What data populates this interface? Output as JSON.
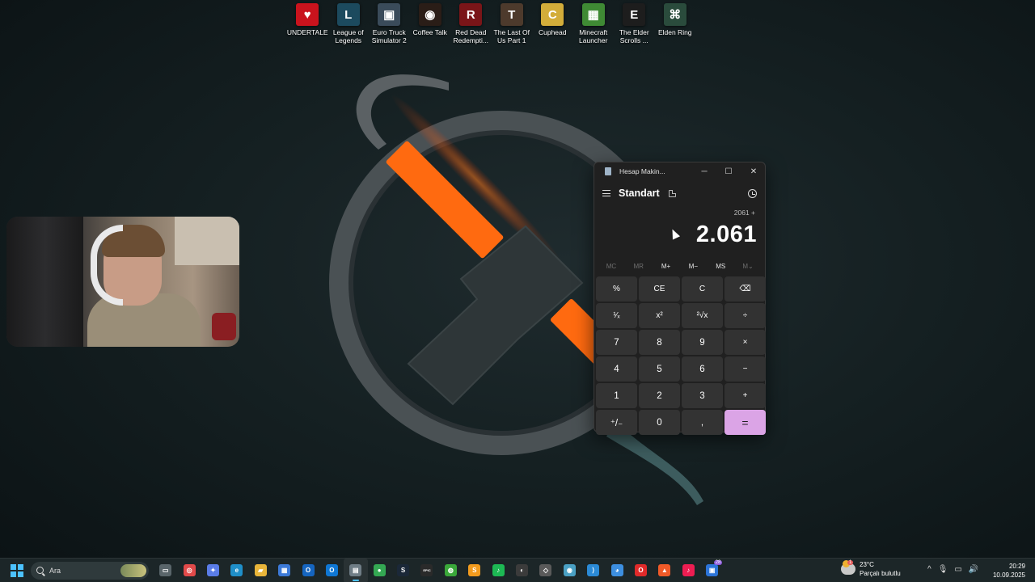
{
  "desktop_icons": [
    {
      "label": "UNDERTALE",
      "color": "#c9131d",
      "glyph": "♥"
    },
    {
      "label": "League of Legends",
      "color": "#1c4a5e",
      "glyph": "L"
    },
    {
      "label": "Euro Truck Simulator 2",
      "color": "#3a4b5a",
      "glyph": "▣"
    },
    {
      "label": "Coffee Talk",
      "color": "#2a1d17",
      "glyph": "◉"
    },
    {
      "label": "Red Dead Redempti...",
      "color": "#7a1518",
      "glyph": "R"
    },
    {
      "label": "The Last Of Us Part 1",
      "color": "#4d3a2c",
      "glyph": "T"
    },
    {
      "label": "Cuphead",
      "color": "#d3ad3a",
      "glyph": "C"
    },
    {
      "label": "Minecraft Launcher",
      "color": "#3f8a34",
      "glyph": "▦"
    },
    {
      "label": "The Elder Scrolls ...",
      "color": "#1d1d1d",
      "glyph": "E"
    },
    {
      "label": "Elden Ring",
      "color": "#2a4b3c",
      "glyph": "⌘"
    }
  ],
  "calculator": {
    "window_title": "Hesap Makin...",
    "mode": "Standart",
    "expression": "2061 +",
    "display": "2.061",
    "memory": [
      {
        "label": "MC",
        "enabled": false
      },
      {
        "label": "MR",
        "enabled": false
      },
      {
        "label": "M+",
        "enabled": true
      },
      {
        "label": "M−",
        "enabled": true
      },
      {
        "label": "MS",
        "enabled": true
      },
      {
        "label": "M⌄",
        "enabled": false
      }
    ],
    "keys": [
      {
        "label": "%",
        "kind": "op",
        "name": "percent-button"
      },
      {
        "label": "CE",
        "kind": "op",
        "name": "clear-entry-button"
      },
      {
        "label": "C",
        "kind": "op",
        "name": "clear-button"
      },
      {
        "label": "⌫",
        "kind": "op",
        "name": "backspace-button"
      },
      {
        "label": "¹⁄ₓ",
        "kind": "op",
        "name": "reciprocal-button"
      },
      {
        "label": "x²",
        "kind": "op",
        "name": "square-button"
      },
      {
        "label": "²√x",
        "kind": "op",
        "name": "square-root-button"
      },
      {
        "label": "÷",
        "kind": "op",
        "name": "divide-button"
      },
      {
        "label": "7",
        "kind": "num",
        "name": "digit-7-button"
      },
      {
        "label": "8",
        "kind": "num",
        "name": "digit-8-button"
      },
      {
        "label": "9",
        "kind": "num",
        "name": "digit-9-button"
      },
      {
        "label": "×",
        "kind": "op",
        "name": "multiply-button"
      },
      {
        "label": "4",
        "kind": "num",
        "name": "digit-4-button"
      },
      {
        "label": "5",
        "kind": "num",
        "name": "digit-5-button"
      },
      {
        "label": "6",
        "kind": "num",
        "name": "digit-6-button"
      },
      {
        "label": "−",
        "kind": "op",
        "name": "subtract-button"
      },
      {
        "label": "1",
        "kind": "num",
        "name": "digit-1-button"
      },
      {
        "label": "2",
        "kind": "num",
        "name": "digit-2-button"
      },
      {
        "label": "3",
        "kind": "num",
        "name": "digit-3-button"
      },
      {
        "label": "+",
        "kind": "op",
        "name": "add-button"
      },
      {
        "label": "⁺/₋",
        "kind": "num",
        "name": "negate-button"
      },
      {
        "label": "0",
        "kind": "num",
        "name": "digit-0-button"
      },
      {
        "label": ",",
        "kind": "num",
        "name": "decimal-button"
      },
      {
        "label": "=",
        "kind": "eq",
        "name": "equals-button"
      }
    ]
  },
  "taskbar": {
    "search_placeholder": "Ara",
    "apps": [
      {
        "name": "task-view",
        "glyph": "▭",
        "color": "#59656a"
      },
      {
        "name": "chrome-game",
        "glyph": "◎",
        "color": "#e24a4a"
      },
      {
        "name": "copilot",
        "glyph": "✦",
        "color": "#5a7de8"
      },
      {
        "name": "edge",
        "glyph": "e",
        "color": "#1f8fc9"
      },
      {
        "name": "file-explorer",
        "glyph": "▰",
        "color": "#e8b53a"
      },
      {
        "name": "store",
        "glyph": "▦",
        "color": "#3c7ad8"
      },
      {
        "name": "outlook",
        "glyph": "O",
        "color": "#1565c0"
      },
      {
        "name": "outlook-new",
        "glyph": "O",
        "color": "#0f77d4"
      },
      {
        "name": "calculator",
        "glyph": "▤",
        "color": "#6f7d86"
      },
      {
        "name": "chrome",
        "glyph": "●",
        "color": "#34a853"
      },
      {
        "name": "steam",
        "glyph": "S",
        "color": "#1b2838"
      },
      {
        "name": "epic-games",
        "glyph": "EPIC",
        "color": "#2a2a2a"
      },
      {
        "name": "xbox-like",
        "glyph": "◍",
        "color": "#3aa83a"
      },
      {
        "name": "sublime",
        "glyph": "S",
        "color": "#f29b1e"
      },
      {
        "name": "spotify",
        "glyph": "♪",
        "color": "#1db954"
      },
      {
        "name": "obs",
        "glyph": "◐",
        "color": "#3b3b3b"
      },
      {
        "name": "unity-like",
        "glyph": "◇",
        "color": "#5a5a5a"
      },
      {
        "name": "globe",
        "glyph": "◉",
        "color": "#4aa0c4"
      },
      {
        "name": "vscode",
        "glyph": "⟩",
        "color": "#2b8ad6"
      },
      {
        "name": "whale-app",
        "glyph": "◕",
        "color": "#3d8fe0"
      },
      {
        "name": "opera",
        "glyph": "O",
        "color": "#e02a2a"
      },
      {
        "name": "brave",
        "glyph": "▲",
        "color": "#f05a28"
      },
      {
        "name": "tiktok",
        "glyph": "♪",
        "color": "#ee1d52"
      },
      {
        "name": "discord-like",
        "glyph": "▣",
        "color": "#2c74d8",
        "badge": "28"
      }
    ],
    "weather": {
      "temp": "23°C",
      "condition": "Parçalı bulutlu",
      "badge": "1"
    },
    "tray": [
      "^",
      "🎙",
      "▭",
      "🔊"
    ],
    "time": "20:29",
    "date": "10.09.2025"
  }
}
